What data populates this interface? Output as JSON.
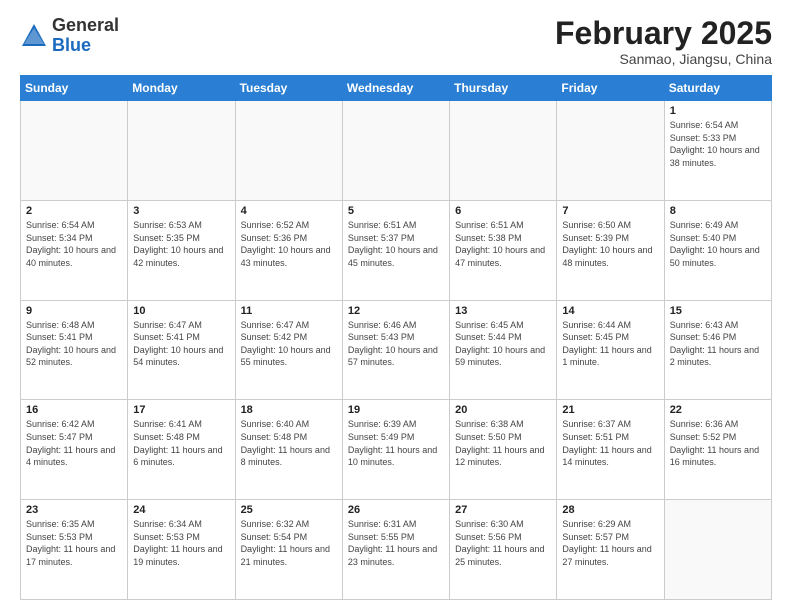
{
  "header": {
    "logo_general": "General",
    "logo_blue": "Blue",
    "month_year": "February 2025",
    "location": "Sanmao, Jiangsu, China"
  },
  "days_of_week": [
    "Sunday",
    "Monday",
    "Tuesday",
    "Wednesday",
    "Thursday",
    "Friday",
    "Saturday"
  ],
  "weeks": [
    [
      {
        "day": "",
        "info": ""
      },
      {
        "day": "",
        "info": ""
      },
      {
        "day": "",
        "info": ""
      },
      {
        "day": "",
        "info": ""
      },
      {
        "day": "",
        "info": ""
      },
      {
        "day": "",
        "info": ""
      },
      {
        "day": "1",
        "info": "Sunrise: 6:54 AM\nSunset: 5:33 PM\nDaylight: 10 hours and 38 minutes."
      }
    ],
    [
      {
        "day": "2",
        "info": "Sunrise: 6:54 AM\nSunset: 5:34 PM\nDaylight: 10 hours and 40 minutes."
      },
      {
        "day": "3",
        "info": "Sunrise: 6:53 AM\nSunset: 5:35 PM\nDaylight: 10 hours and 42 minutes."
      },
      {
        "day": "4",
        "info": "Sunrise: 6:52 AM\nSunset: 5:36 PM\nDaylight: 10 hours and 43 minutes."
      },
      {
        "day": "5",
        "info": "Sunrise: 6:51 AM\nSunset: 5:37 PM\nDaylight: 10 hours and 45 minutes."
      },
      {
        "day": "6",
        "info": "Sunrise: 6:51 AM\nSunset: 5:38 PM\nDaylight: 10 hours and 47 minutes."
      },
      {
        "day": "7",
        "info": "Sunrise: 6:50 AM\nSunset: 5:39 PM\nDaylight: 10 hours and 48 minutes."
      },
      {
        "day": "8",
        "info": "Sunrise: 6:49 AM\nSunset: 5:40 PM\nDaylight: 10 hours and 50 minutes."
      }
    ],
    [
      {
        "day": "9",
        "info": "Sunrise: 6:48 AM\nSunset: 5:41 PM\nDaylight: 10 hours and 52 minutes."
      },
      {
        "day": "10",
        "info": "Sunrise: 6:47 AM\nSunset: 5:41 PM\nDaylight: 10 hours and 54 minutes."
      },
      {
        "day": "11",
        "info": "Sunrise: 6:47 AM\nSunset: 5:42 PM\nDaylight: 10 hours and 55 minutes."
      },
      {
        "day": "12",
        "info": "Sunrise: 6:46 AM\nSunset: 5:43 PM\nDaylight: 10 hours and 57 minutes."
      },
      {
        "day": "13",
        "info": "Sunrise: 6:45 AM\nSunset: 5:44 PM\nDaylight: 10 hours and 59 minutes."
      },
      {
        "day": "14",
        "info": "Sunrise: 6:44 AM\nSunset: 5:45 PM\nDaylight: 11 hours and 1 minute."
      },
      {
        "day": "15",
        "info": "Sunrise: 6:43 AM\nSunset: 5:46 PM\nDaylight: 11 hours and 2 minutes."
      }
    ],
    [
      {
        "day": "16",
        "info": "Sunrise: 6:42 AM\nSunset: 5:47 PM\nDaylight: 11 hours and 4 minutes."
      },
      {
        "day": "17",
        "info": "Sunrise: 6:41 AM\nSunset: 5:48 PM\nDaylight: 11 hours and 6 minutes."
      },
      {
        "day": "18",
        "info": "Sunrise: 6:40 AM\nSunset: 5:48 PM\nDaylight: 11 hours and 8 minutes."
      },
      {
        "day": "19",
        "info": "Sunrise: 6:39 AM\nSunset: 5:49 PM\nDaylight: 11 hours and 10 minutes."
      },
      {
        "day": "20",
        "info": "Sunrise: 6:38 AM\nSunset: 5:50 PM\nDaylight: 11 hours and 12 minutes."
      },
      {
        "day": "21",
        "info": "Sunrise: 6:37 AM\nSunset: 5:51 PM\nDaylight: 11 hours and 14 minutes."
      },
      {
        "day": "22",
        "info": "Sunrise: 6:36 AM\nSunset: 5:52 PM\nDaylight: 11 hours and 16 minutes."
      }
    ],
    [
      {
        "day": "23",
        "info": "Sunrise: 6:35 AM\nSunset: 5:53 PM\nDaylight: 11 hours and 17 minutes."
      },
      {
        "day": "24",
        "info": "Sunrise: 6:34 AM\nSunset: 5:53 PM\nDaylight: 11 hours and 19 minutes."
      },
      {
        "day": "25",
        "info": "Sunrise: 6:32 AM\nSunset: 5:54 PM\nDaylight: 11 hours and 21 minutes."
      },
      {
        "day": "26",
        "info": "Sunrise: 6:31 AM\nSunset: 5:55 PM\nDaylight: 11 hours and 23 minutes."
      },
      {
        "day": "27",
        "info": "Sunrise: 6:30 AM\nSunset: 5:56 PM\nDaylight: 11 hours and 25 minutes."
      },
      {
        "day": "28",
        "info": "Sunrise: 6:29 AM\nSunset: 5:57 PM\nDaylight: 11 hours and 27 minutes."
      },
      {
        "day": "",
        "info": ""
      }
    ]
  ]
}
